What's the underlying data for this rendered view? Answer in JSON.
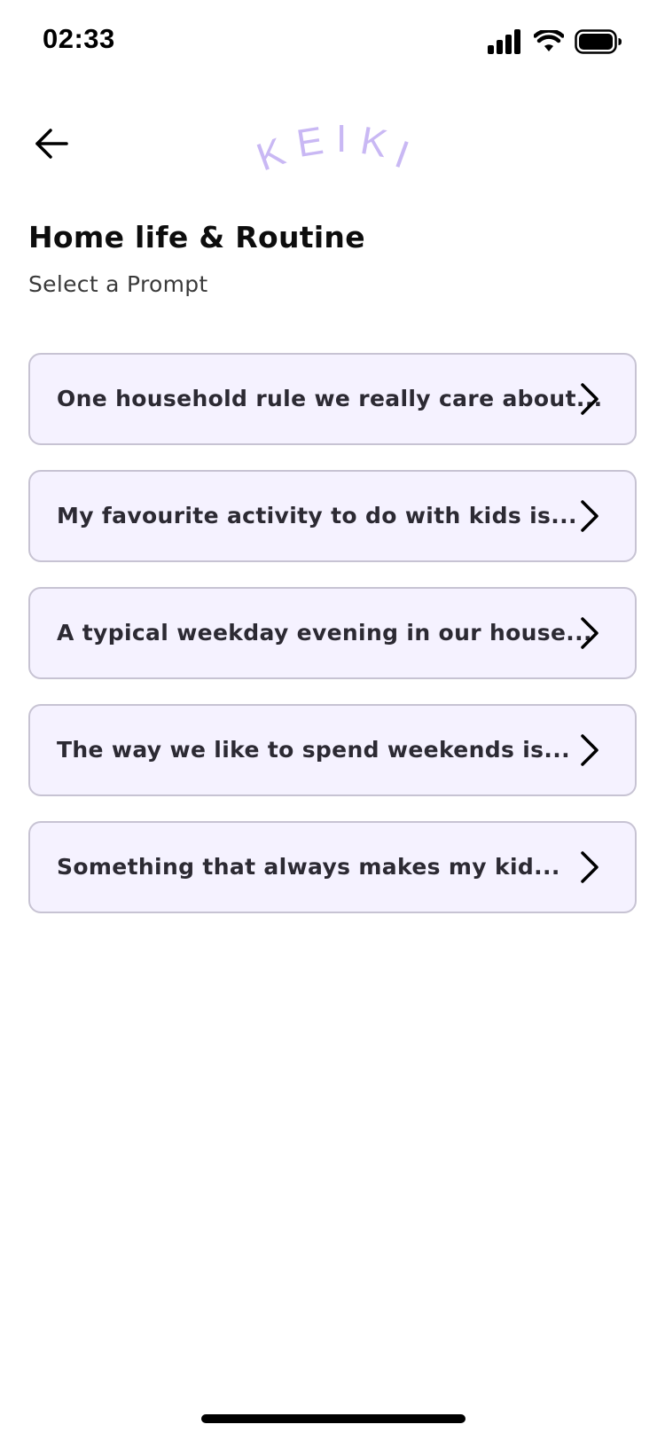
{
  "status_bar": {
    "time": "02:33",
    "icons": [
      "signal-icon",
      "wifi-icon",
      "battery-icon"
    ]
  },
  "header": {
    "back_icon": "arrow-left-icon",
    "logo_text": "KEIKI",
    "logo_color": "#c9b8f4"
  },
  "page": {
    "title": "Home life & Routine",
    "subtitle": "Select a Prompt"
  },
  "prompts": [
    {
      "label": "One household rule we really care about..."
    },
    {
      "label": "My favourite activity to do with kids is..."
    },
    {
      "label": "A typical weekday evening in our house..."
    },
    {
      "label": "The way we like to spend weekends is..."
    },
    {
      "label": "Something that always makes my kid..."
    }
  ],
  "colors": {
    "card_background": "#f5f2ff",
    "card_border": "#c7c3d3",
    "accent": "#c9b8f4"
  }
}
